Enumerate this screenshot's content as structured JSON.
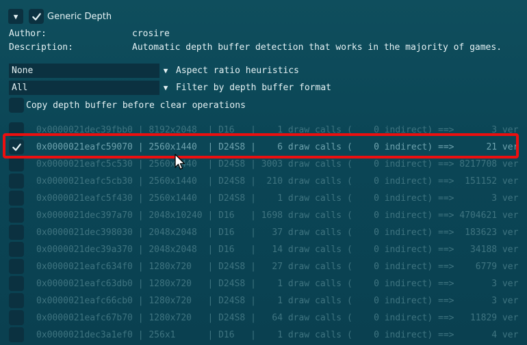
{
  "header": {
    "title": "Generic Depth",
    "collapse_icon": "triangle-down-icon",
    "enabled": true
  },
  "info": {
    "author_label": "Author:",
    "author_value": "crosire",
    "description_label": "Description:",
    "description_value": "Automatic depth buffer detection that works in the majority of games."
  },
  "aspect_combo": {
    "value": "None",
    "label": "Aspect ratio heuristics"
  },
  "format_combo": {
    "value": "All",
    "label": "Filter by depth buffer format"
  },
  "copy_option": {
    "label": "Copy depth buffer before clear operations",
    "checked": false
  },
  "buffers": [
    {
      "text": "0x0000021dec39fbb0 | 8192x2048  | D16   |    1 draw calls (    0 indirect) ==>       3 ver",
      "checked": false
    },
    {
      "text": "0x0000021eafc59070 | 2560x1440  | D24S8 |    6 draw calls (    0 indirect) ==>      21 ver",
      "checked": true
    },
    {
      "text": "0x0000021eafc5c530 | 2560x1440  | D24S8 | 3003 draw calls (    0 indirect) ==> 8217708 ver",
      "checked": false
    },
    {
      "text": "0x0000021eafc5cb30 | 2560x1440  | D24S8 |  210 draw calls (    0 indirect) ==>  151152 ver",
      "checked": false
    },
    {
      "text": "0x0000021eafc5f430 | 2560x1440  | D24S8 |    1 draw calls (    0 indirect) ==>       3 ver",
      "checked": false
    },
    {
      "text": "0x0000021dec397a70 | 2048x10240 | D16   | 1698 draw calls (    0 indirect) ==> 4704621 ver",
      "checked": false
    },
    {
      "text": "0x0000021dec398030 | 2048x2048  | D16   |   37 draw calls (    0 indirect) ==>  183623 ver",
      "checked": false
    },
    {
      "text": "0x0000021dec39a370 | 2048x2048  | D16   |   14 draw calls (    0 indirect) ==>   34188 ver",
      "checked": false
    },
    {
      "text": "0x0000021eafc634f0 | 1280x720   | D24S8 |   27 draw calls (    0 indirect) ==>    6779 ver",
      "checked": false
    },
    {
      "text": "0x0000021eafc63db0 | 1280x720   | D24S8 |    1 draw calls (    0 indirect) ==>       3 ver",
      "checked": false
    },
    {
      "text": "0x0000021eafc66cb0 | 1280x720   | D24S8 |    1 draw calls (    0 indirect) ==>       3 ver",
      "checked": false
    },
    {
      "text": "0x0000021eafc67b70 | 1280x720   | D24S8 |   64 draw calls (    0 indirect) ==>   11829 ver",
      "checked": false
    },
    {
      "text": "0x0000021dec3a1ef0 | 256x1      | D16   |    1 draw calls (    0 indirect) ==>       4 ver",
      "checked": false
    }
  ],
  "colors": {
    "accent_highlight": "#ec0f0f",
    "panel_bg": "#0f4e5d",
    "control_bg": "#0b3140"
  }
}
